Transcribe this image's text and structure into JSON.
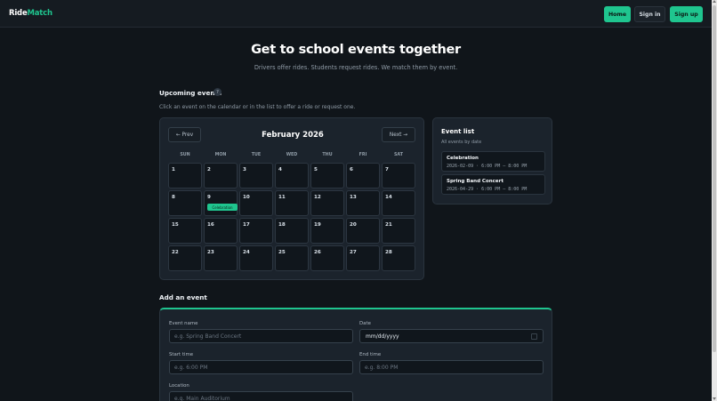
{
  "brand": {
    "part1": "Ride",
    "part2": "Match"
  },
  "nav": {
    "home": "Home",
    "sign_in": "Sign in",
    "sign_up": "Sign up"
  },
  "hero": {
    "title": "Get to school events together",
    "subtitle": "Drivers offer rides. Students request rides. We match them by event."
  },
  "upcoming": {
    "title": "Upcoming events",
    "help": "?",
    "hint": "Click an event on the calendar or in the list to offer a ride or request one."
  },
  "calendar": {
    "prev": "← Prev",
    "next": "Next →",
    "month": "February 2026",
    "weekdays": [
      "SUN",
      "MON",
      "TUE",
      "WED",
      "THU",
      "FRI",
      "SAT"
    ],
    "days": [
      "1",
      "2",
      "3",
      "4",
      "5",
      "6",
      "7",
      "8",
      "9",
      "10",
      "11",
      "12",
      "13",
      "14",
      "15",
      "16",
      "17",
      "18",
      "19",
      "20",
      "21",
      "22",
      "23",
      "24",
      "25",
      "26",
      "27",
      "28"
    ],
    "event_label": "Celebration"
  },
  "event_list": {
    "title": "Event list",
    "subtitle": "All events by date",
    "items": [
      {
        "name": "Celebration",
        "meta": "2026-02-09 · 6:00 PM – 8:00 PM"
      },
      {
        "name": "Spring Band Concert",
        "meta": "2026-04-29 · 6:00 PM – 8:00 PM"
      }
    ]
  },
  "add_event": {
    "title": "Add an event",
    "event_name_label": "Event name",
    "event_name_placeholder": "e.g. Spring Band Concert",
    "date_label": "Date",
    "date_value": "mm/dd/yyyy",
    "start_label": "Start time",
    "start_placeholder": "e.g. 6:00 PM",
    "end_label": "End time",
    "end_placeholder": "e.g. 8:00 PM",
    "location_label": "Location",
    "location_placeholder": "e.g. Main Auditorium"
  },
  "colors": {
    "accent": "#1fc58f",
    "background": "#10151a",
    "card": "#1b232c"
  }
}
